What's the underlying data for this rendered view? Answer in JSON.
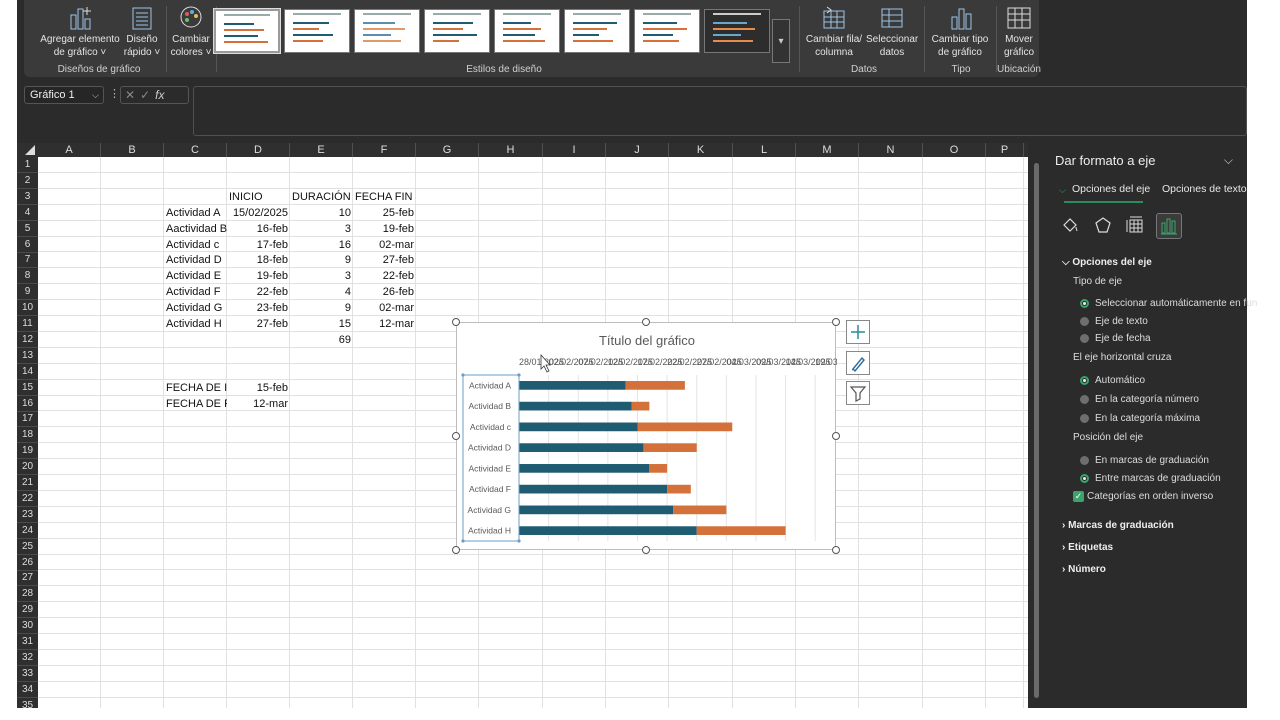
{
  "ribbon": {
    "buttons": [
      {
        "label": "Agregar elemento\nde gráfico ˅",
        "icon": "add-chart-element-icon"
      },
      {
        "label": "Diseño\nrápido ˅",
        "icon": "quick-layout-icon"
      },
      {
        "label": "Cambiar\ncolores ˅",
        "icon": "palette-icon"
      },
      {
        "label": "Cambiar fila/\ncolumna",
        "icon": "switch-row-column-icon"
      },
      {
        "label": "Seleccionar\ndatos",
        "icon": "select-data-icon"
      },
      {
        "label": "Cambiar tipo\nde gráfico",
        "icon": "chart-type-icon"
      },
      {
        "label": "Mover\ngráfico",
        "icon": "move-chart-icon"
      }
    ],
    "groups": [
      "Diseños de gráfico",
      "Estilos de diseño",
      "Datos",
      "Tipo",
      "Ubicación"
    ]
  },
  "formula_bar": {
    "name_box": "Gráfico 1",
    "cancel": "✕",
    "enter": "✓",
    "fx": "fx",
    "formula": ""
  },
  "sheet": {
    "columns": [
      "A",
      "B",
      "C",
      "D",
      "E",
      "F",
      "G",
      "H",
      "I",
      "J",
      "K",
      "L",
      "M",
      "N",
      "O",
      "P"
    ],
    "rows": [
      "1",
      "2",
      "3",
      "4",
      "5",
      "6",
      "7",
      "8",
      "9",
      "10",
      "11",
      "12",
      "13",
      "14",
      "15",
      "16",
      "17",
      "18",
      "19",
      "20",
      "21",
      "22",
      "23",
      "24",
      "25",
      "26",
      "27",
      "28",
      "29",
      "30",
      "31",
      "32",
      "33",
      "34",
      "35"
    ],
    "headers": {
      "inicio": "INICIO",
      "duracion": "DURACIÓN",
      "fin": "FECHA FIN"
    },
    "tasks": [
      {
        "name": "Actividad A",
        "start": "15/02/2025",
        "dur": "10",
        "end": "25-feb"
      },
      {
        "name": "Aactividad B",
        "start": "16-feb",
        "dur": "3",
        "end": "19-feb"
      },
      {
        "name": "Actividad c",
        "start": "17-feb",
        "dur": "16",
        "end": "02-mar"
      },
      {
        "name": "Actividad D",
        "start": "18-feb",
        "dur": "9",
        "end": "27-feb"
      },
      {
        "name": "Actividad E",
        "start": "19-feb",
        "dur": "3",
        "end": "22-feb"
      },
      {
        "name": "Actividad F",
        "start": "22-feb",
        "dur": "4",
        "end": "26-feb"
      },
      {
        "name": "Actividad G",
        "start": "23-feb",
        "dur": "9",
        "end": "02-mar"
      },
      {
        "name": "Actividad H",
        "start": "27-feb",
        "dur": "15",
        "end": "12-mar"
      }
    ],
    "total": "69",
    "fecha_ini_label": "FECHA DE INI",
    "fecha_ini_val": "15-feb",
    "fecha_fin_label": "FECHA DE FIN",
    "fecha_fin_val": "12-mar"
  },
  "chart_data": {
    "type": "bar",
    "title": "Título del gráfico",
    "categories": [
      "Actividad A",
      "Actividad B",
      "Actividad c",
      "Actividad D",
      "Actividad E",
      "Actividad F",
      "Actividad G",
      "Actividad H"
    ],
    "series": [
      {
        "values": [
          "2025-02-15",
          "2025-02-16",
          "2025-02-17",
          "2025-02-18",
          "2025-02-19",
          "2025-02-22",
          "2025-02-23",
          "2025-02-27"
        ],
        "color": "#1f5c72"
      },
      {
        "values": [
          10,
          3,
          16,
          9,
          3,
          4,
          9,
          15
        ],
        "color": "#d4713a"
      }
    ],
    "x_tick_labels": [
      "28/01/2025",
      "02/02/2025",
      "07/02/2025",
      "12/02/2025",
      "17/02/2025",
      "22/02/2025",
      "27/02/2025",
      "04/03/2025",
      "09/03/2025",
      "14/03/2025",
      "19/03/2025"
    ],
    "xlim": [
      "2025-01-28",
      "2025-03-22"
    ],
    "axis_position": "top",
    "categories_reversed": true,
    "grid": true
  },
  "pane": {
    "title": "Dar formato a eje",
    "tab_axis": "Opciones del eje",
    "tab_text": "Opciones de texto",
    "section_axis": "Opciones del eje",
    "axis_type_label": "Tipo de eje",
    "axis_type_options": [
      "Seleccionar automáticamente en fun",
      "Eje de texto",
      "Eje de fecha"
    ],
    "cross_label": "El eje horizontal cruza",
    "cross_options": [
      "Automático",
      "En la categoría número",
      "En la categoría máxima"
    ],
    "position_label": "Posición del eje",
    "position_options": [
      "En marcas de graduación",
      "Entre marcas de graduación"
    ],
    "reverse_label": "Categorías en orden inverso",
    "collapsed_sections": [
      "Marcas de graduación",
      "Etiquetas",
      "Número"
    ]
  },
  "colors": {
    "accent": "#3ba46c",
    "bar_start": "#1f5c72",
    "bar_duration": "#d4713a"
  }
}
